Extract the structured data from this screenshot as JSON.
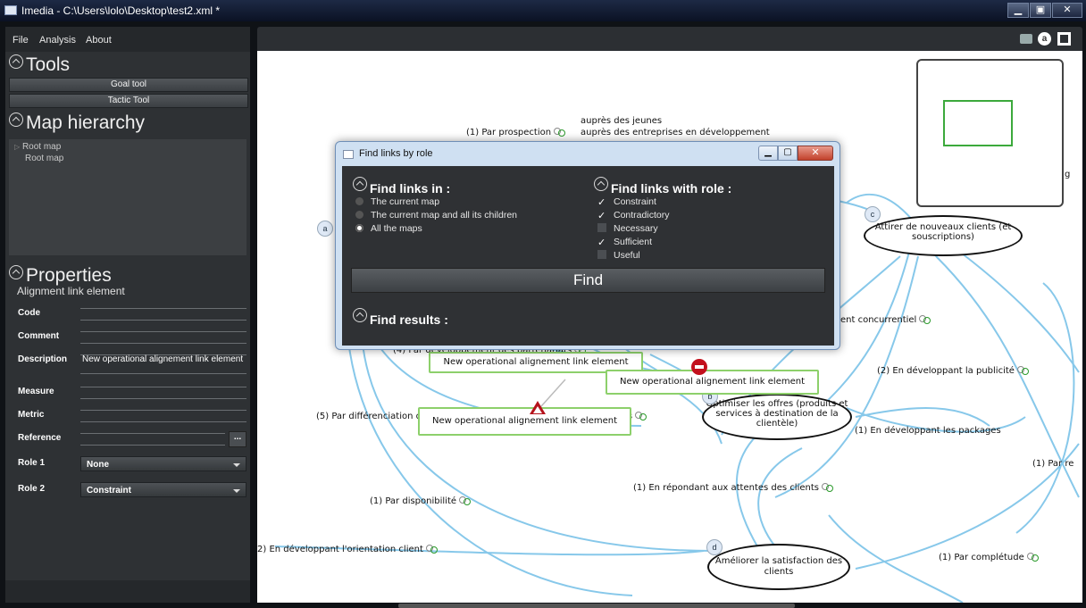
{
  "window": {
    "title": "Imedia - C:\\Users\\lolo\\Desktop\\test2.xml *"
  },
  "menu": [
    "File",
    "Analysis",
    "About"
  ],
  "tools": {
    "header": "Tools",
    "goal_tool": "Goal tool",
    "tactic_tool": "Tactic Tool"
  },
  "hierarchy": {
    "header": "Map hierarchy",
    "items": [
      "Root map",
      "Root map"
    ]
  },
  "properties": {
    "header": "Properties",
    "subtitle": "Alignment link element",
    "code": "Code",
    "comment": "Comment",
    "description_label": "Description",
    "description_value": "New operational alignement link element",
    "measure": "Measure",
    "metric": "Metric",
    "reference": "Reference",
    "reference_btn": "...",
    "role1_label": "Role 1",
    "role1_value": "None",
    "role2_label": "Role 2",
    "role2_value": "Constraint"
  },
  "canvas_toolbar": {
    "icons": [
      "camera-icon",
      "a-toggle-icon",
      "fit-icon"
    ],
    "badge": "a"
  },
  "map": {
    "texts": {
      "aupres_jeunes": "auprès des jeunes",
      "par_prospection": "(1) Par prospection",
      "aupres_entreprises": "auprès des entreprises en développement",
      "concurrentiel": "ent concurrentiel",
      "partenariats": "(4) Par développement des partenariats",
      "publicite": "(2) En développant la publicité",
      "differenciation": "(5) Par différenciation des offres et approches part typologie de clients",
      "packages": "(1) En développant les packages",
      "par_re": "(1) Par re",
      "repondant": "(1) En répondant aux attentes  des clients",
      "disponibilite": "(1) Par disponibilité",
      "orientation": "2) En développant l'orientation client",
      "completude": "(1) Par complétude",
      "edge_g": "g"
    },
    "goals": {
      "c_badge": "c",
      "c_text": "Attirer de nouveaux clients (et souscriptions)",
      "b_badge": "b",
      "b_text": "Optimiser les offres (produits et services à destination de la clientèle)",
      "d_badge": "d",
      "d_text": "Améliorer la satisfaction des clients",
      "a_badge": "a"
    },
    "alignment_boxes": [
      "New operational alignement link element",
      "New operational alignement link element",
      "New operational alignement link element"
    ]
  },
  "dialog": {
    "title": "Find links by role",
    "find_in_header": "Find links in :",
    "scopes": [
      "The current map",
      "The current map and all its children",
      "All the maps"
    ],
    "selected_scope": "All the maps",
    "role_header": "Find links with role :",
    "roles": [
      {
        "label": "Constraint",
        "checked": true
      },
      {
        "label": "Contradictory",
        "checked": true
      },
      {
        "label": "Necessary",
        "checked": false
      },
      {
        "label": "Sufficient",
        "checked": true
      },
      {
        "label": "Useful",
        "checked": false
      }
    ],
    "find_button": "Find",
    "results_header": "Find results :"
  }
}
